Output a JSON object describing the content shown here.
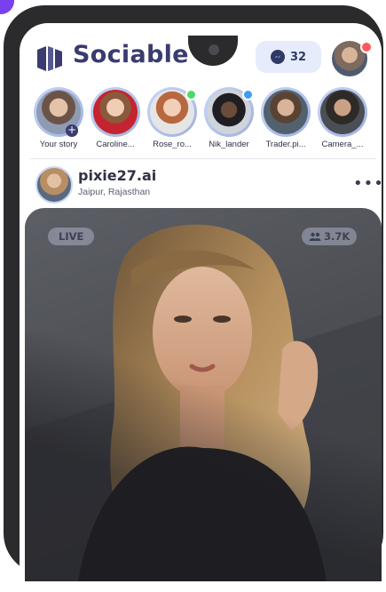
{
  "app": {
    "title": "Sociable"
  },
  "header": {
    "message_count": "32"
  },
  "stories": [
    {
      "label": "Your story",
      "has_add": true,
      "online": ""
    },
    {
      "label": "Caroline...",
      "online": ""
    },
    {
      "label": "Rose_ro...",
      "online": "#4cd964"
    },
    {
      "label": "Nik_lander",
      "online": "#3b9ff5"
    },
    {
      "label": "Trader.pi...",
      "online": ""
    },
    {
      "label": "Camera_...",
      "online": ""
    }
  ],
  "post": {
    "username": "pixie27.ai",
    "location": "Jaipur, Rajasthan",
    "live_label": "LIVE",
    "viewers": "3.7K"
  },
  "colors": {
    "brand": "#3a3b6e",
    "accent_light": "#e6ecfb",
    "notification": "#ff5a5a"
  }
}
